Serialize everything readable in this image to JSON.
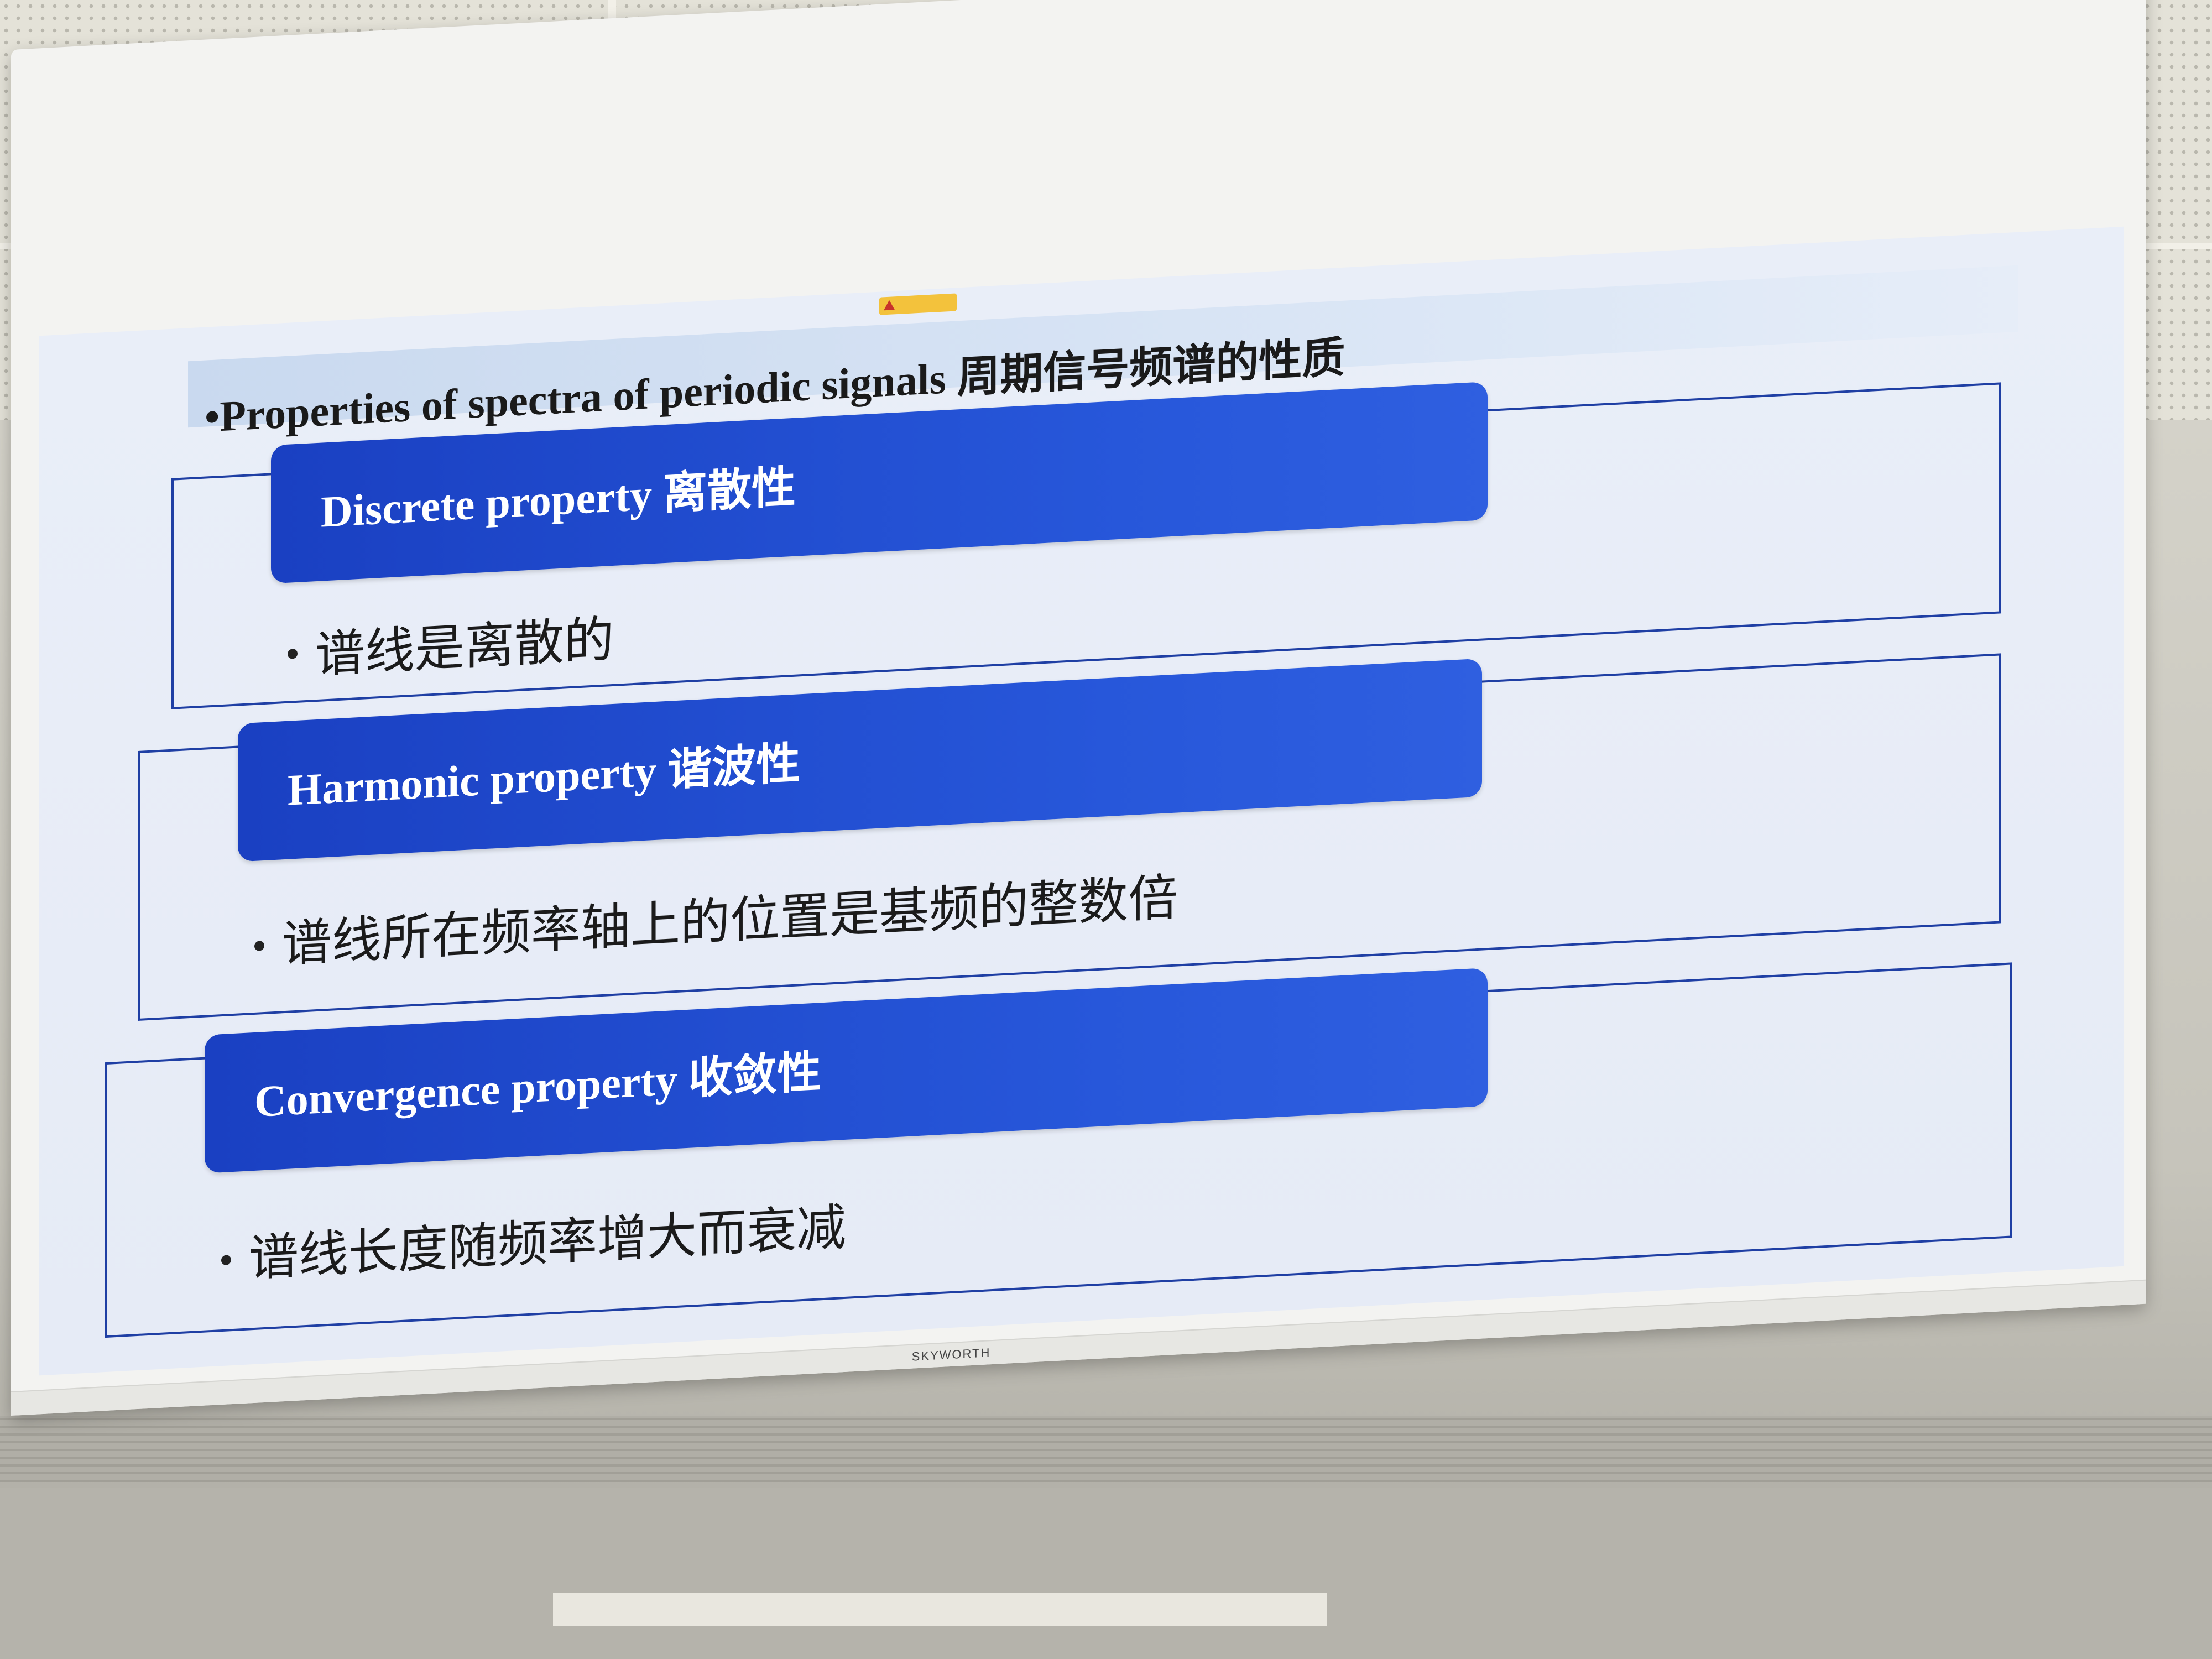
{
  "tv": {
    "brand": "SKYWORTH"
  },
  "slide": {
    "title": "•Properties of spectra of periodic signals 周期信号频谱的性质",
    "sections": [
      {
        "heading": "Discrete property 离散性",
        "bullet": "谱线是离散的"
      },
      {
        "heading": "Harmonic property 谐波性",
        "bullet": "谱线所在频率轴上的位置是基频的整数倍"
      },
      {
        "heading": "Convergence property 收敛性",
        "bullet": "谱线长度随频率增大而衰减"
      }
    ]
  },
  "colors": {
    "pill": "#2050d0",
    "frame": "#1f3fa4",
    "screen_bg": "#e8edf7"
  }
}
